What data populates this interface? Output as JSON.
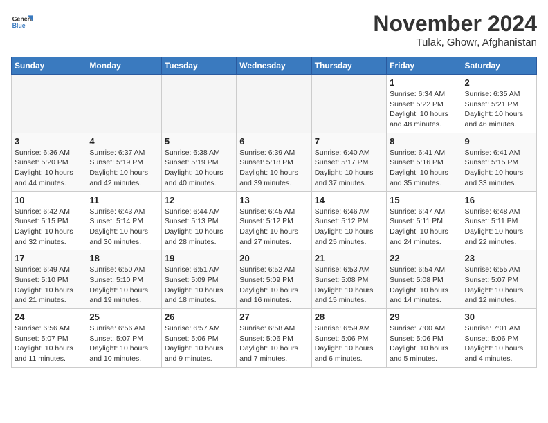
{
  "header": {
    "logo": {
      "general": "General",
      "blue": "Blue"
    },
    "month": "November 2024",
    "location": "Tulak, Ghowr, Afghanistan"
  },
  "weekdays": [
    "Sunday",
    "Monday",
    "Tuesday",
    "Wednesday",
    "Thursday",
    "Friday",
    "Saturday"
  ],
  "weeks": [
    [
      {
        "day": "",
        "info": ""
      },
      {
        "day": "",
        "info": ""
      },
      {
        "day": "",
        "info": ""
      },
      {
        "day": "",
        "info": ""
      },
      {
        "day": "",
        "info": ""
      },
      {
        "day": "1",
        "info": "Sunrise: 6:34 AM\nSunset: 5:22 PM\nDaylight: 10 hours and 48 minutes."
      },
      {
        "day": "2",
        "info": "Sunrise: 6:35 AM\nSunset: 5:21 PM\nDaylight: 10 hours and 46 minutes."
      }
    ],
    [
      {
        "day": "3",
        "info": "Sunrise: 6:36 AM\nSunset: 5:20 PM\nDaylight: 10 hours and 44 minutes."
      },
      {
        "day": "4",
        "info": "Sunrise: 6:37 AM\nSunset: 5:19 PM\nDaylight: 10 hours and 42 minutes."
      },
      {
        "day": "5",
        "info": "Sunrise: 6:38 AM\nSunset: 5:19 PM\nDaylight: 10 hours and 40 minutes."
      },
      {
        "day": "6",
        "info": "Sunrise: 6:39 AM\nSunset: 5:18 PM\nDaylight: 10 hours and 39 minutes."
      },
      {
        "day": "7",
        "info": "Sunrise: 6:40 AM\nSunset: 5:17 PM\nDaylight: 10 hours and 37 minutes."
      },
      {
        "day": "8",
        "info": "Sunrise: 6:41 AM\nSunset: 5:16 PM\nDaylight: 10 hours and 35 minutes."
      },
      {
        "day": "9",
        "info": "Sunrise: 6:41 AM\nSunset: 5:15 PM\nDaylight: 10 hours and 33 minutes."
      }
    ],
    [
      {
        "day": "10",
        "info": "Sunrise: 6:42 AM\nSunset: 5:15 PM\nDaylight: 10 hours and 32 minutes."
      },
      {
        "day": "11",
        "info": "Sunrise: 6:43 AM\nSunset: 5:14 PM\nDaylight: 10 hours and 30 minutes."
      },
      {
        "day": "12",
        "info": "Sunrise: 6:44 AM\nSunset: 5:13 PM\nDaylight: 10 hours and 28 minutes."
      },
      {
        "day": "13",
        "info": "Sunrise: 6:45 AM\nSunset: 5:12 PM\nDaylight: 10 hours and 27 minutes."
      },
      {
        "day": "14",
        "info": "Sunrise: 6:46 AM\nSunset: 5:12 PM\nDaylight: 10 hours and 25 minutes."
      },
      {
        "day": "15",
        "info": "Sunrise: 6:47 AM\nSunset: 5:11 PM\nDaylight: 10 hours and 24 minutes."
      },
      {
        "day": "16",
        "info": "Sunrise: 6:48 AM\nSunset: 5:11 PM\nDaylight: 10 hours and 22 minutes."
      }
    ],
    [
      {
        "day": "17",
        "info": "Sunrise: 6:49 AM\nSunset: 5:10 PM\nDaylight: 10 hours and 21 minutes."
      },
      {
        "day": "18",
        "info": "Sunrise: 6:50 AM\nSunset: 5:10 PM\nDaylight: 10 hours and 19 minutes."
      },
      {
        "day": "19",
        "info": "Sunrise: 6:51 AM\nSunset: 5:09 PM\nDaylight: 10 hours and 18 minutes."
      },
      {
        "day": "20",
        "info": "Sunrise: 6:52 AM\nSunset: 5:09 PM\nDaylight: 10 hours and 16 minutes."
      },
      {
        "day": "21",
        "info": "Sunrise: 6:53 AM\nSunset: 5:08 PM\nDaylight: 10 hours and 15 minutes."
      },
      {
        "day": "22",
        "info": "Sunrise: 6:54 AM\nSunset: 5:08 PM\nDaylight: 10 hours and 14 minutes."
      },
      {
        "day": "23",
        "info": "Sunrise: 6:55 AM\nSunset: 5:07 PM\nDaylight: 10 hours and 12 minutes."
      }
    ],
    [
      {
        "day": "24",
        "info": "Sunrise: 6:56 AM\nSunset: 5:07 PM\nDaylight: 10 hours and 11 minutes."
      },
      {
        "day": "25",
        "info": "Sunrise: 6:56 AM\nSunset: 5:07 PM\nDaylight: 10 hours and 10 minutes."
      },
      {
        "day": "26",
        "info": "Sunrise: 6:57 AM\nSunset: 5:06 PM\nDaylight: 10 hours and 9 minutes."
      },
      {
        "day": "27",
        "info": "Sunrise: 6:58 AM\nSunset: 5:06 PM\nDaylight: 10 hours and 7 minutes."
      },
      {
        "day": "28",
        "info": "Sunrise: 6:59 AM\nSunset: 5:06 PM\nDaylight: 10 hours and 6 minutes."
      },
      {
        "day": "29",
        "info": "Sunrise: 7:00 AM\nSunset: 5:06 PM\nDaylight: 10 hours and 5 minutes."
      },
      {
        "day": "30",
        "info": "Sunrise: 7:01 AM\nSunset: 5:06 PM\nDaylight: 10 hours and 4 minutes."
      }
    ]
  ]
}
